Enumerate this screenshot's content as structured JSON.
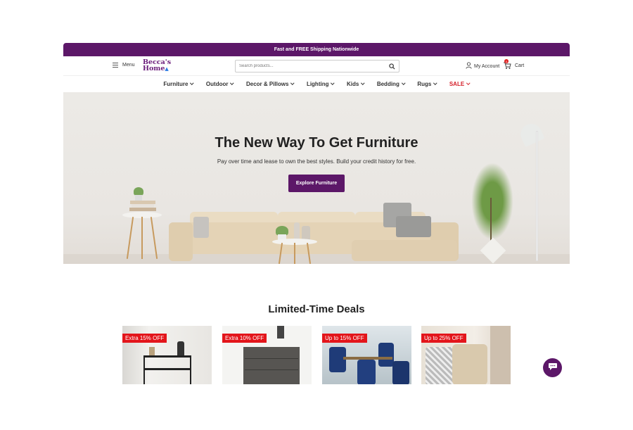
{
  "promo": {
    "text": "Fast and FREE Shipping Nationwide"
  },
  "header": {
    "menu_label": "Menu",
    "logo_line1": "Becca's",
    "logo_line2": "Home",
    "search_placeholder": "Search products...",
    "account_label": "My Account",
    "cart_label": "Cart",
    "cart_count": "0"
  },
  "nav": {
    "items": [
      {
        "label": "Furniture"
      },
      {
        "label": "Outdoor"
      },
      {
        "label": "Decor & Pillows"
      },
      {
        "label": "Lighting"
      },
      {
        "label": "Kids"
      },
      {
        "label": "Bedding"
      },
      {
        "label": "Rugs"
      },
      {
        "label": "SALE"
      }
    ]
  },
  "hero": {
    "title": "The New Way To Get Furniture",
    "subtitle": "Pay over time and lease to own the best styles. Build your credit history for free.",
    "button": "Explore Furniture"
  },
  "deals": {
    "title": "Limited-Time Deals",
    "cards": [
      {
        "badge": "Extra 15% OFF"
      },
      {
        "badge": "Extra 10% OFF"
      },
      {
        "badge": "Up to 15% OFF"
      },
      {
        "badge": "Up to 25% OFF"
      }
    ]
  },
  "colors": {
    "brand_purple": "#5c1768",
    "sale_red": "#d4202a",
    "badge_red": "#e3151b",
    "logo_blue": "#2a7be4"
  }
}
